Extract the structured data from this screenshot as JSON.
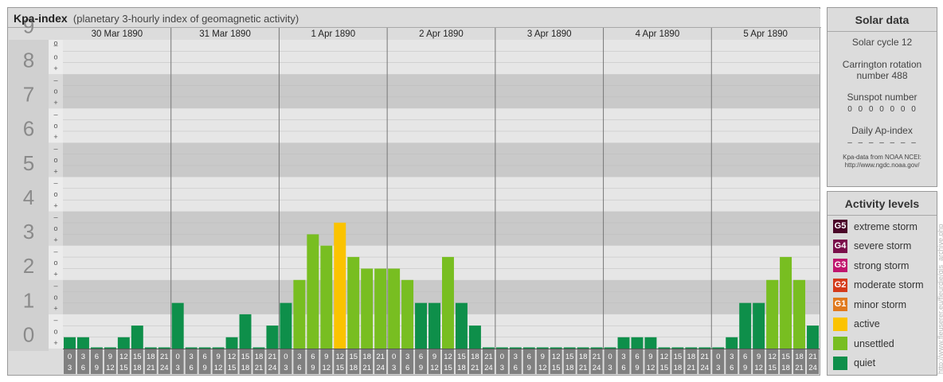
{
  "header": {
    "title": "Kpa-index",
    "subtitle": "(planetary 3-hourly index of geomagnetic activity)"
  },
  "chart_data": {
    "type": "bar",
    "ylim": [
      0,
      9
    ],
    "y_major_ticks": [
      "0",
      "1",
      "2",
      "3",
      "4",
      "5",
      "6",
      "7",
      "8",
      "9"
    ],
    "y_minor_marks": [
      "+",
      "o",
      "–"
    ],
    "days": [
      "30 Mar 1890",
      "31 Mar 1890",
      "1 Apr 1890",
      "2 Apr 1890",
      "3 Apr 1890",
      "4 Apr 1890",
      "5 Apr 1890"
    ],
    "interval_start_labels": [
      "0",
      "3",
      "6",
      "9",
      "12",
      "15",
      "18",
      "21"
    ],
    "interval_end_labels": [
      "3",
      "6",
      "9",
      "12",
      "15",
      "18",
      "21",
      "24"
    ],
    "values": [
      0.33,
      0.33,
      0,
      0,
      0.33,
      0.67,
      0,
      0,
      1.33,
      0,
      0,
      0,
      0.33,
      1,
      0,
      0.67,
      1.33,
      2,
      3.33,
      3,
      3.67,
      2.67,
      2.33,
      2.33,
      2.33,
      2,
      1.33,
      1.33,
      2.67,
      1.33,
      0.67,
      0,
      0,
      0,
      0,
      0,
      0,
      0,
      0,
      0,
      0,
      0.33,
      0.33,
      0.33,
      0,
      0,
      0,
      0,
      0,
      0.33,
      1.33,
      1.33,
      2,
      2.67,
      2,
      0.67
    ],
    "colors": {
      "quiet": "#0e8f4a",
      "unsettled": "#78be21",
      "active": "#fbc300",
      "minor_storm": "#e07a1e",
      "moderate_storm": "#d43a1a",
      "strong_storm": "#c0166e",
      "severe_storm": "#7a0f4a",
      "extreme_storm": "#4a0628"
    }
  },
  "solar": {
    "title": "Solar data",
    "cycle": "Solar cycle 12",
    "carrington_line1": "Carrington rotation",
    "carrington_line2": "number 488",
    "sunspot_label": "Sunspot number",
    "sunspot_values": "0 0 0 0 0 0 0",
    "ap_label": "Daily Ap-index",
    "ap_values": "– – – – – – –",
    "source_line1": "Kpa-data from NOAA NCEI:",
    "source_line2": "http://www.ngdc.noaa.gov/"
  },
  "activity": {
    "title": "Activity levels",
    "items": [
      {
        "badge": "G5",
        "label": "extreme storm",
        "color": "#4a0628"
      },
      {
        "badge": "G4",
        "label": "severe storm",
        "color": "#7a0f4a"
      },
      {
        "badge": "G3",
        "label": "strong storm",
        "color": "#c0166e"
      },
      {
        "badge": "G2",
        "label": "moderate storm",
        "color": "#d43a1a"
      },
      {
        "badge": "G1",
        "label": "minor storm",
        "color": "#e07a1e"
      },
      {
        "badge": "",
        "label": "active",
        "color": "#fbc300"
      },
      {
        "badge": "",
        "label": "unsettled",
        "color": "#78be21"
      },
      {
        "badge": "",
        "label": "quiet",
        "color": "#0e8f4a"
      }
    ]
  },
  "watermark": "http://www.fleuserer.eu/fleurdie/gjs_archive.php"
}
